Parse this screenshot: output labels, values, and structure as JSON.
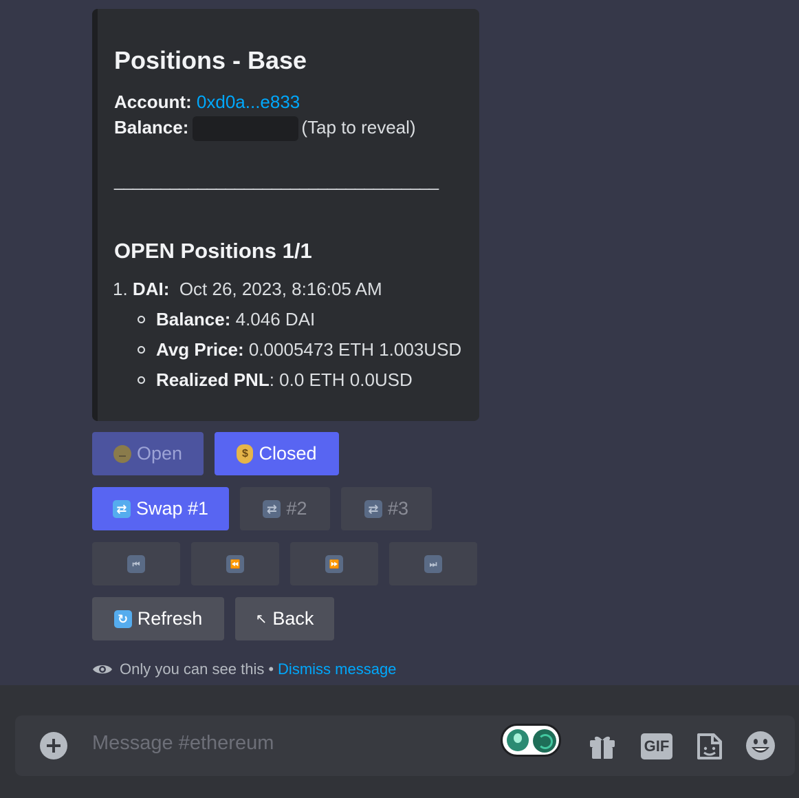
{
  "embed": {
    "title": "Positions - Base",
    "account_label": "Account:",
    "account_value": "0xd0a...e833",
    "balance_label": "Balance:",
    "balance_hint": "(Tap to reveal)",
    "divider": "___________________________________",
    "section_title": "OPEN Positions 1/1",
    "position": {
      "index": "1.",
      "token": "DAI:",
      "timestamp": "Oct 26, 2023, 8:16:05 AM",
      "details": [
        {
          "label": "Balance:",
          "value": "4.046 DAI"
        },
        {
          "label": "Avg Price:",
          "value": "0.0005473 ETH 1.003USD"
        },
        {
          "label": "Realized PNL",
          "value": ": 0.0 ETH 0.0USD"
        }
      ]
    }
  },
  "buttons": {
    "open": "Open",
    "closed": "Closed",
    "swap1": "Swap #1",
    "swap2": "#2",
    "swap3": "#3",
    "refresh": "Refresh",
    "back": "Back",
    "back_icon": "↖"
  },
  "ephemeral": {
    "text": "Only you can see this",
    "separator": "•",
    "dismiss": "Dismiss message"
  },
  "composer": {
    "placeholder": "Message #ethereum",
    "gif_label": "GIF"
  },
  "icons": {
    "swap": "repeat-icon",
    "first": "first-page-icon",
    "prev": "rewind-icon",
    "next": "fast-forward-icon",
    "last": "last-page-icon",
    "refresh": "refresh-icon"
  },
  "colors": {
    "primary": "#5865f2",
    "link": "#00a8fc",
    "background": "#363849",
    "embed": "#2b2d31"
  }
}
